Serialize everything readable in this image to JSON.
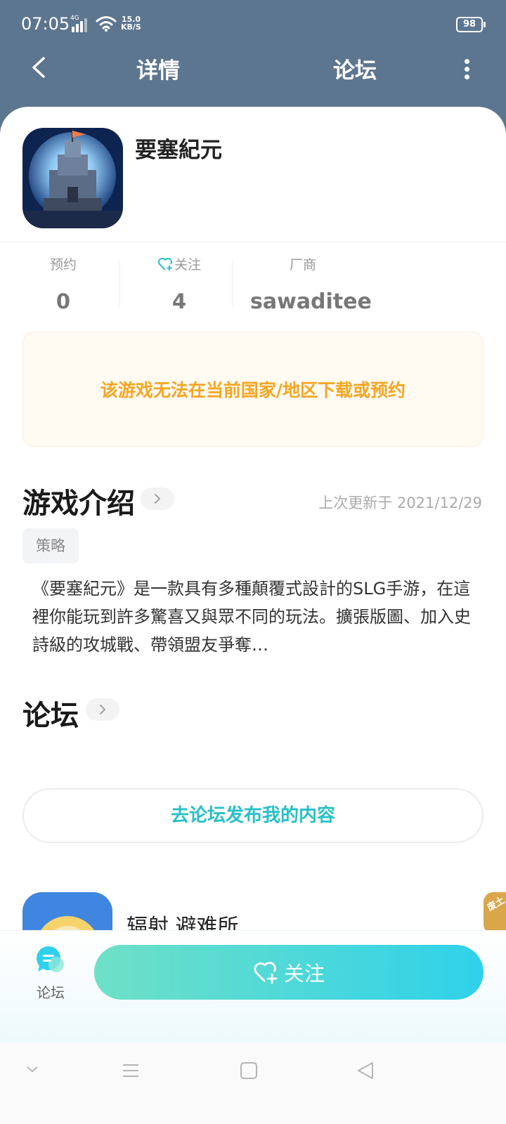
{
  "status_bar": {
    "time": "07:05",
    "network": "4G",
    "speed_value": "15.0",
    "speed_unit": "KB/S",
    "battery": "98"
  },
  "nav": {
    "tab_details": "详情",
    "tab_forum": "论坛"
  },
  "game": {
    "title": "要塞紀元"
  },
  "stats": {
    "reserve_label": "预约",
    "reserve_value": "0",
    "follow_label": "关注",
    "follow_value": "4",
    "vendor_label": "厂商",
    "vendor_value": "sawaditee"
  },
  "notice": "该游戏无法在当前国家/地区下载或预约",
  "intro": {
    "title": "游戏介绍",
    "updated": "上次更新于 2021/12/29",
    "tag": "策略",
    "description": "《要塞紀元》是一款具有多種顛覆式設計的SLG手游，在這裡你能玩到許多驚喜又與眾不同的玩法。擴張版圖、加入史詩級的攻城戰、帶領盟友爭奪…"
  },
  "forum": {
    "title": "论坛",
    "post_button": "去论坛发布我的内容"
  },
  "recommend": {
    "title": "辐射 避难所",
    "peek_label": "废土"
  },
  "bottom": {
    "forum_tab": "论坛",
    "follow_button": "关注"
  },
  "colors": {
    "header": "#5d7690",
    "accent": "#27c0c6",
    "notice": "#f5a623"
  }
}
